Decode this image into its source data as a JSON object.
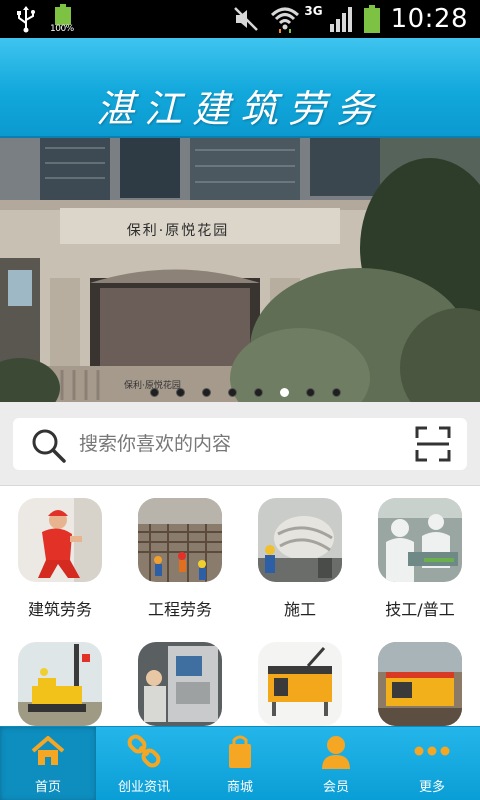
{
  "status_bar": {
    "battery_label": "100%",
    "network_type": "3G",
    "time": "10:28"
  },
  "header": {
    "title": "湛江建筑劳务"
  },
  "banner": {
    "sign_text": "保利·原悦花园",
    "sign_text_small": "保利·原悦花园",
    "slide_count": 8,
    "active_slide": 6
  },
  "search": {
    "placeholder": "搜索你喜欢的内容"
  },
  "categories": [
    {
      "label": "建筑劳务",
      "icon": "worker-icon"
    },
    {
      "label": "工程劳务",
      "icon": "construction-site-icon"
    },
    {
      "label": "施工",
      "icon": "concrete-mixer-icon"
    },
    {
      "label": "技工/普工",
      "icon": "factory-workers-icon"
    },
    {
      "label": "",
      "icon": "drilling-rig-icon"
    },
    {
      "label": "",
      "icon": "cnc-machine-icon"
    },
    {
      "label": "",
      "icon": "rebar-bender-icon"
    },
    {
      "label": "",
      "icon": "cutting-machine-icon"
    }
  ],
  "tabs": [
    {
      "label": "首页",
      "icon": "home-icon"
    },
    {
      "label": "创业资讯",
      "icon": "link-icon"
    },
    {
      "label": "商城",
      "icon": "shopping-bag-icon"
    },
    {
      "label": "会员",
      "icon": "member-icon"
    },
    {
      "label": "更多",
      "icon": "more-icon"
    }
  ],
  "colors": {
    "accent": "#12a8dc",
    "tab_icon": "#f5a623",
    "active_tab": "#0d8ebf"
  }
}
